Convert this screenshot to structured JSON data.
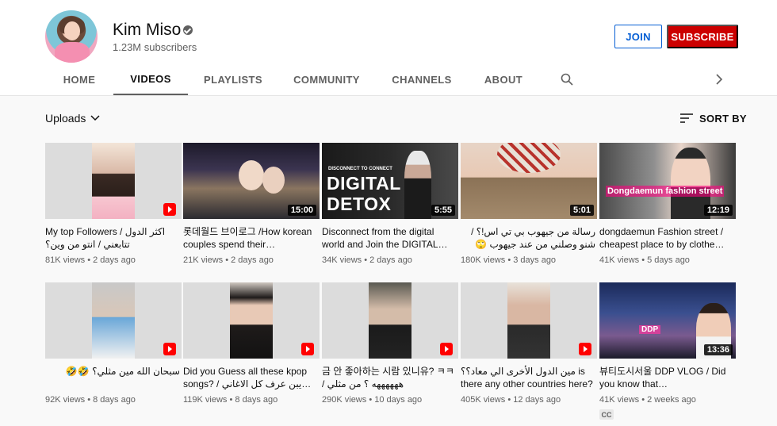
{
  "channel": {
    "name": "Kim Miso",
    "subscribers": "1.23M subscribers",
    "join_label": "JOIN",
    "subscribe_label": "SUBSCRIBE",
    "accent_color": "#cc0000"
  },
  "tabs": [
    {
      "label": "HOME"
    },
    {
      "label": "VIDEOS",
      "active": true
    },
    {
      "label": "PLAYLISTS"
    },
    {
      "label": "COMMUNITY"
    },
    {
      "label": "CHANNELS"
    },
    {
      "label": "ABOUT"
    }
  ],
  "toolbar": {
    "uploads_label": "Uploads",
    "sort_label": "SORT BY"
  },
  "videos": [
    {
      "title": "My top Followers / اكثر الدول تتابعني / انتو من وين؟",
      "views": "81K views",
      "age": "2 days ago",
      "short": true
    },
    {
      "title": "롯데월드 브이로그 /How korean couples spend their…",
      "views": "21K views",
      "age": "2 days ago",
      "duration": "15:00"
    },
    {
      "title": "Disconnect from the digital world and Join the DIGITAL…",
      "views": "34K views",
      "age": "2 days ago",
      "duration": "5:55",
      "thumb_text": "DIGITAL DETOX",
      "thumb_caption": "DISCONNECT TO CONNECT"
    },
    {
      "title": "رسالة من جيهوب بي تي اس!؟ / شنو وصلني من عند جيهوب 🙄",
      "views": "180K views",
      "age": "3 days ago",
      "duration": "5:01"
    },
    {
      "title": "dongdaemun Fashion street / cheapest place to by clothe…",
      "views": "41K views",
      "age": "5 days ago",
      "duration": "12:19",
      "thumb_text": "Dongdaemun fashion street"
    },
    {
      "title": "سبحان الله مين مثلي؟ 🤣🤣",
      "views": "92K views",
      "age": "8 days ago",
      "short": true
    },
    {
      "title": "Did you Guess all these kpop songs? / يبن عرف كل الاغاني برفع…",
      "views": "119K views",
      "age": "8 days ago",
      "short": true
    },
    {
      "title": "금 안 좋아하는 시람 있니유? ㅋㅋ / ههههههه ؟ من مثلي",
      "views": "290K views",
      "age": "10 days ago",
      "short": true
    },
    {
      "title": "مين الدول الأخرى الي معاد؟؟ is there any other countries here?",
      "views": "405K views",
      "age": "12 days ago",
      "short": true
    },
    {
      "title": "뷰티도시서울 DDP VLOG / Did you know that…",
      "views": "41K views",
      "age": "2 weeks ago",
      "duration": "13:36",
      "cc": "CC",
      "thumb_text": "DDP"
    }
  ]
}
